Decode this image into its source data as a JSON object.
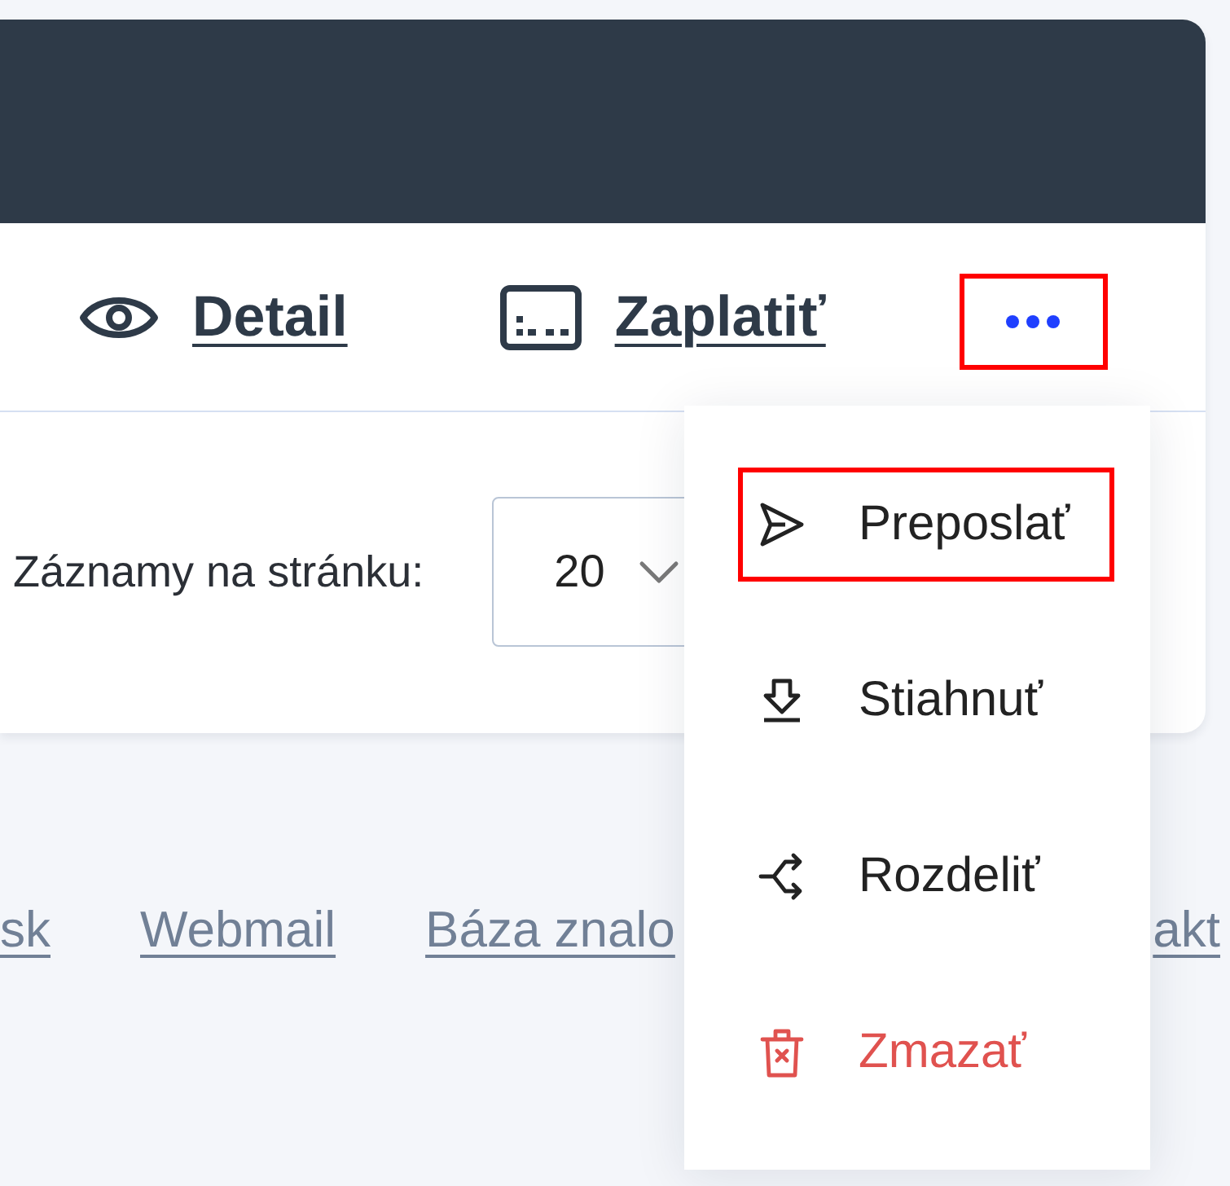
{
  "actions": [
    {
      "kind": "view",
      "label": "Detail"
    },
    {
      "kind": "pay",
      "label": "Zaplatiť"
    }
  ],
  "more_button": {
    "highlighted": true
  },
  "page_size": {
    "label": "Záznamy na stránku:",
    "value": "20"
  },
  "footer_links": [
    "sk",
    "Webmail",
    "Báza znalo",
    "akt"
  ],
  "menu": {
    "open": true,
    "items": [
      {
        "kind": "forward",
        "label": "Preposlať",
        "highlighted": true
      },
      {
        "kind": "download",
        "label": "Stiahnuť",
        "highlighted": false
      },
      {
        "kind": "split",
        "label": "Rozdeliť",
        "highlighted": false
      },
      {
        "kind": "delete",
        "label": "Zmazať",
        "highlighted": false
      }
    ]
  }
}
